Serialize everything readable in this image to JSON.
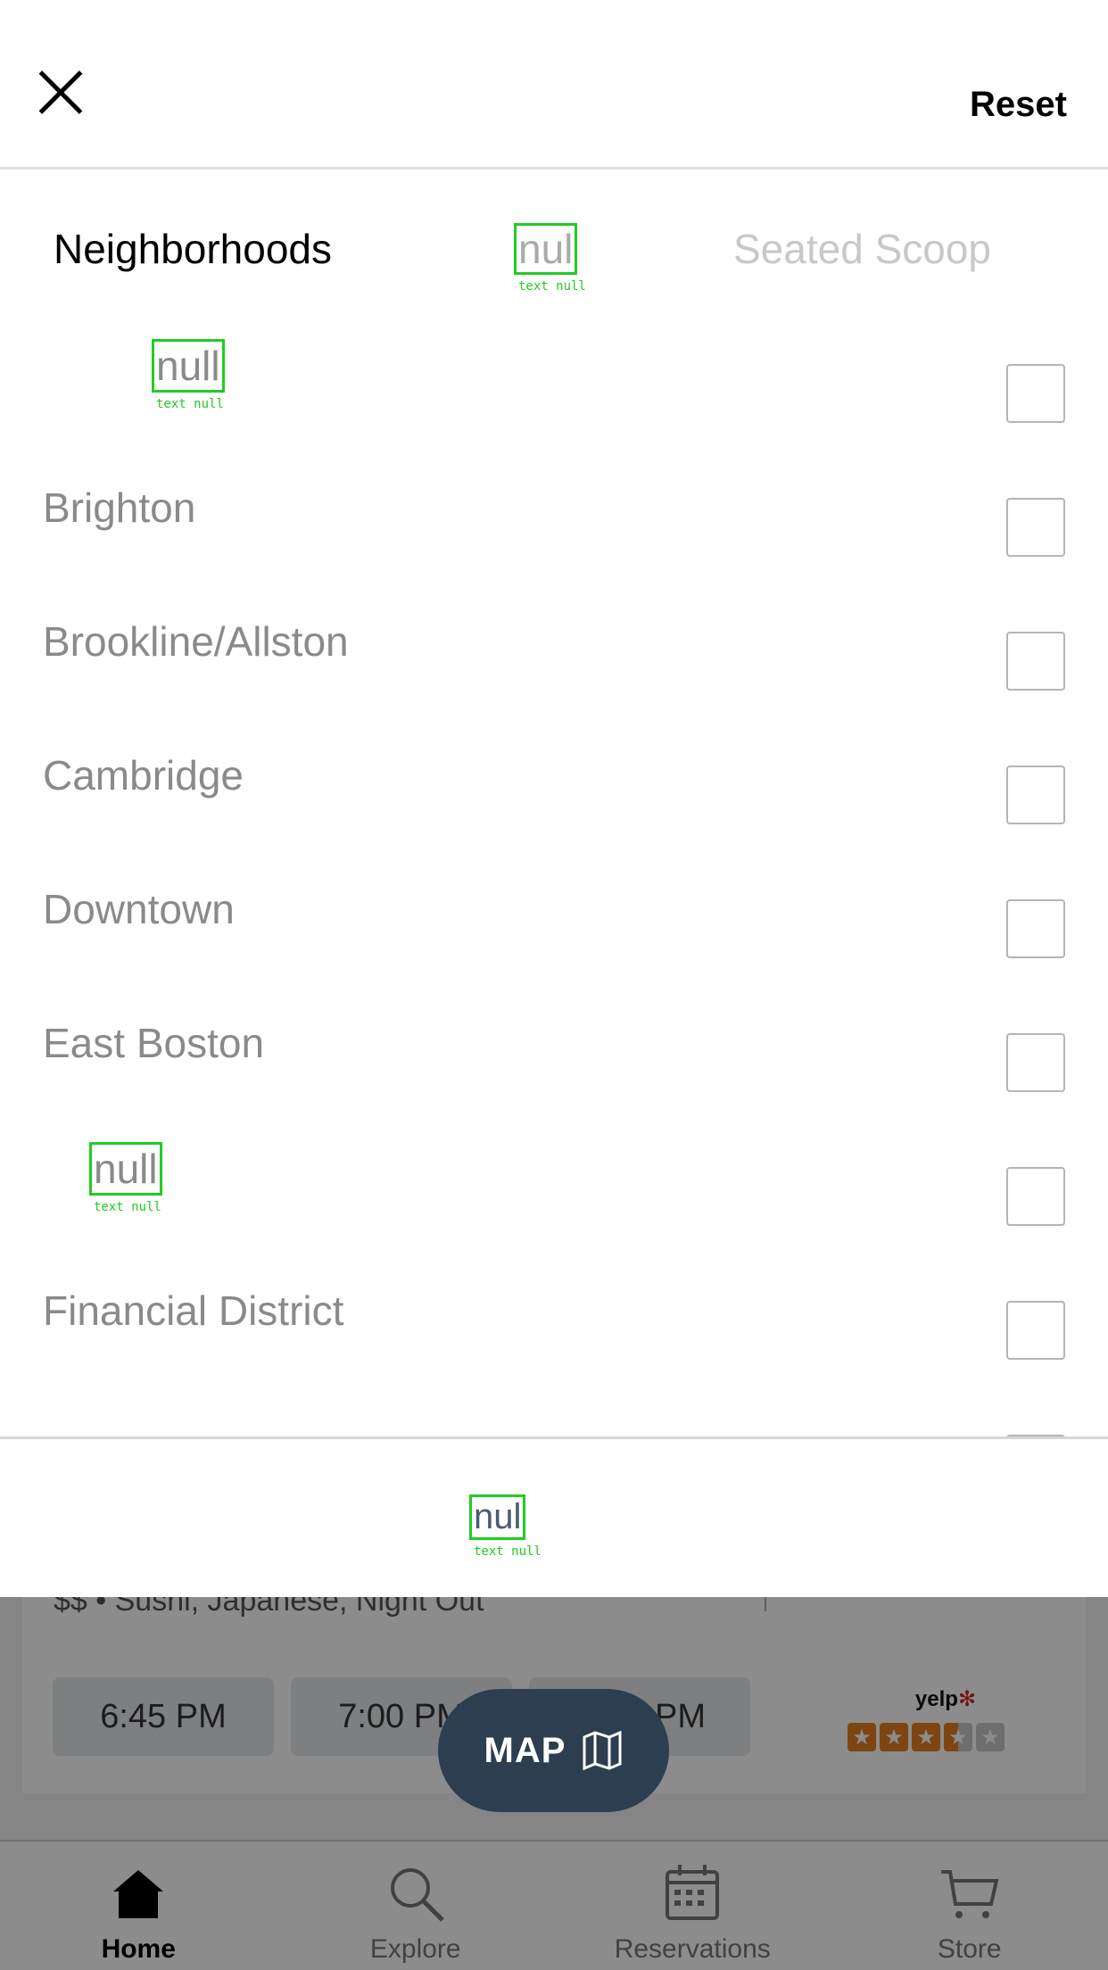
{
  "sheet": {
    "close_icon": "close-icon",
    "reset_label": "Reset"
  },
  "filter_tabs": [
    {
      "label": "Neighborhoods",
      "active": true
    },
    {
      "label": "nul",
      "annotation": "text null"
    },
    {
      "label": "Seated Scoop"
    }
  ],
  "neighborhoods": [
    {
      "label": "null",
      "annotation": "text null"
    },
    {
      "label": "Brighton"
    },
    {
      "label": "Brookline/Allston"
    },
    {
      "label": "Cambridge"
    },
    {
      "label": "Downtown"
    },
    {
      "label": "East Boston"
    },
    {
      "label": "null",
      "annotation": "text null"
    },
    {
      "label": "Financial District"
    }
  ],
  "footer": {
    "button_label": "nul",
    "annotation": "text null"
  },
  "background": {
    "card_meta": "$$ • Sushi, Japanese, Night Out",
    "times": [
      "6:45 PM",
      "7:00 PM",
      "PM"
    ],
    "yelp_label": "yelp",
    "rating_stars": 3.5,
    "map_button": "MAP"
  },
  "tabbar": [
    {
      "label": "Home",
      "icon": "home-icon",
      "active": true
    },
    {
      "label": "Explore",
      "icon": "search-icon"
    },
    {
      "label": "Reservations",
      "icon": "calendar-icon"
    },
    {
      "label": "Store",
      "icon": "cart-icon"
    }
  ],
  "colors": {
    "map_button": "#2c3e50",
    "star": "#e67e22",
    "annotation_box": "#22cc22"
  }
}
